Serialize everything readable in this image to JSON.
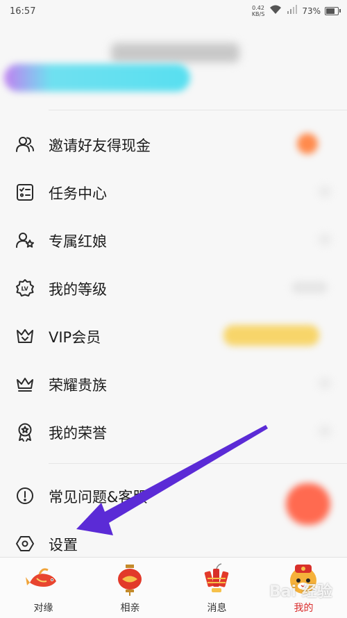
{
  "status_bar": {
    "time": "16:57",
    "net_speed_value": "0.42",
    "net_speed_unit": "KB/S",
    "battery": "73%",
    "battery_level": 0.73
  },
  "menu": {
    "items": [
      {
        "label": "邀请好友得现金",
        "icon": "people-icon"
      },
      {
        "label": "任务中心",
        "icon": "task-checklist-icon"
      },
      {
        "label": "专属红娘",
        "icon": "matchmaker-star-icon"
      },
      {
        "label": "我的等级",
        "icon": "level-badge-icon"
      },
      {
        "label": "VIP会员",
        "icon": "vip-crown-icon"
      },
      {
        "label": "荣耀贵族",
        "icon": "noble-crown-icon"
      },
      {
        "label": "我的荣誉",
        "icon": "honor-medal-icon"
      },
      {
        "label": "常见问题&客服",
        "icon": "info-circle-icon"
      },
      {
        "label": "设置",
        "icon": "settings-hexagon-icon"
      }
    ]
  },
  "tabs": [
    {
      "label": "对缘",
      "icon": "koi-fish-icon",
      "active": false
    },
    {
      "label": "相亲",
      "icon": "red-lantern-icon",
      "active": false
    },
    {
      "label": "消息",
      "icon": "firecracker-icon",
      "active": false
    },
    {
      "label": "我的",
      "icon": "tiger-avatar-icon",
      "active": true
    }
  ],
  "colors": {
    "accent_red": "#d92a2a",
    "annotation_purple": "#5b2bd6",
    "banner_cyan": "#58dff0"
  },
  "watermark": "Bai 经验"
}
